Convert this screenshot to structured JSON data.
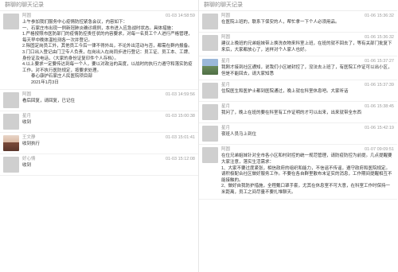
{
  "left_panel": {
    "header": "群聊的聊天记录",
    "messages": [
      {
        "sender": "阿圆",
        "time": "01-03 14:58:59",
        "avatar": "gray",
        "lines": [
          "上午参加我们服务中心疫情防控紧急会议，内容如下：",
          "一、石家庄市出现一例新冠肺炎确诊病例，本市进入应急战时状态。具体措施：",
          "1.严格按照市医防部门的疫情防控责任状的内容要求，对每一名员工个人进行严格管理，每天早中晚体温检测各一次并登记。",
          "2.除固定岗员工外，其他员工今后一律不得外出，不论外出活动与否，都需在群内报备。",
          "3.门口出入登记由门卫专人负责，在岗出入在岗同步进行登记：员工证、员工本、工牌、身份证及电话，（大家的身份证复印件个人存档）。",
          "4.以上要求一定要传达到每一个人，要以对政治的高度，以战时的执行力遵守和落实防疫工作。对不执行医防规定，按要求处理。"
        ],
        "signature": "泰心康护石家庄人民医院项目部",
        "date": "2021年1月3日"
      },
      {
        "sender": "阿圆",
        "time": "01-03 14:59:56",
        "avatar": "gray",
        "lines": [
          "看后回复，请回复，已记住"
        ]
      },
      {
        "sender": "星月",
        "time": "01-03 15:00:38",
        "avatar": "gray",
        "lines": [
          "收到"
        ]
      },
      {
        "sender": "王文静",
        "time": "01-03 15:01:41",
        "avatar": "photo",
        "lines": [
          "收到执行"
        ]
      },
      {
        "sender": "好心情",
        "time": "01-03 15:12:08",
        "avatar": "gray",
        "lines": [
          "收到"
        ]
      }
    ]
  },
  "right_panel": {
    "header": "群聊的聊天记录",
    "messages": [
      {
        "sender": "阿圆",
        "time": "01-06 15:36:32",
        "avatar": "gray",
        "lines": [
          "在医院上班的，联系下保安的人，帮忙拿一下个人必须用品。"
        ]
      },
      {
        "sender": "阿圆",
        "time": "01-06 15:36:32",
        "avatar": "gray",
        "lines": [
          "建议上晚班的兄弟姐妹带上换洗衣物来科室上班，在班的就不回去了，等有关部门批复下来后，大家都放心了，这样对个人家人也好。"
        ]
      },
      {
        "sender": "星月",
        "time": "01-06 15:37:27",
        "avatar": "scene",
        "lines": [
          "我刚才接到社区通知，说我们小区被封控了，没法去上班了，有医院工作证可以出小区，但是不能回去，请大家知悉"
        ]
      },
      {
        "sender": "星月",
        "time": "01-06 15:37:39",
        "avatar": "gray",
        "lines": [
          "住院医生和医护士都到医院通过，晚上就在科室休息吧。大家听话"
        ]
      },
      {
        "sender": "星月",
        "time": "01-06 15:38:45",
        "avatar": "gray",
        "lines": [
          "我问了，晚上在班的要在科室有工作证明的才可以出来，出来就带全东西"
        ]
      },
      {
        "sender": "星月",
        "time": "01-06 15:42:19",
        "avatar": "gray",
        "lines": [
          "夜班人员马上到位"
        ]
      },
      {
        "sender": "阿圆",
        "time": "01-07 09:09:51",
        "avatar": "gray",
        "lines": [
          "在位兄弟姐妹针对全市各小区和村封控的统一规范管理，请防疫防控为前提。几点提醒要大家注意，落实生活需求：",
          "1、大家不要过度紧张，相信政府的组织和能力，不信谣不传谣，遵守政府和医院规定。请积极配合社区做好服务工作。不要在各自群里散布未证实的消息，工作期间提醒相互不能接触的。",
          "2、做好自我防护措施，全程戴口罩手套，尤其在休息室不可大意，在科室工作时保持一米距离，员工之间尽量不要扎堆聊天。"
        ]
      }
    ]
  }
}
